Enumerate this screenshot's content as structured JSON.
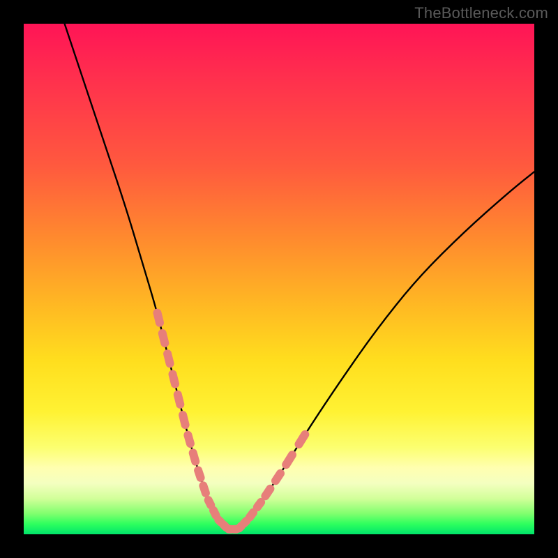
{
  "watermark": "TheBottleneck.com",
  "chart_data": {
    "type": "line",
    "title": "",
    "xlabel": "",
    "ylabel": "",
    "xlim": [
      0,
      100
    ],
    "ylim": [
      0,
      100
    ],
    "grid": false,
    "legend": false,
    "series": [
      {
        "name": "bottleneck-curve",
        "color": "#000000",
        "x": [
          8,
          12,
          16,
          20,
          23,
          26,
          28,
          30,
          32,
          34,
          36,
          38,
          40,
          42,
          44,
          47,
          51,
          56,
          62,
          69,
          77,
          86,
          95,
          100
        ],
        "y": [
          100,
          88,
          76,
          64,
          54,
          44,
          36,
          28,
          20,
          13,
          7,
          3,
          1,
          1,
          3,
          7,
          13,
          21,
          30,
          40,
          50,
          59,
          67,
          71
        ]
      }
    ],
    "annotations": [
      {
        "name": "dotted-segment-left",
        "style": "salmon-dashes",
        "x": [
          26,
          28,
          30,
          32,
          34
        ],
        "y": [
          44,
          36,
          28,
          20,
          13
        ]
      },
      {
        "name": "dotted-segment-bottom",
        "style": "salmon-dashes",
        "x": [
          34,
          36,
          38,
          40,
          42,
          44,
          47
        ],
        "y": [
          13,
          7,
          3,
          1,
          1,
          3,
          7
        ]
      },
      {
        "name": "dotted-segment-right",
        "style": "salmon-dashes",
        "x": [
          47,
          51,
          56
        ],
        "y": [
          7,
          13,
          21
        ]
      }
    ],
    "colors": {
      "gradient_top": "#ff1456",
      "gradient_mid": "#ffde1e",
      "gradient_bottom": "#00e46a",
      "curve": "#000000",
      "dashes": "#e77f7a",
      "frame": "#000000"
    }
  }
}
